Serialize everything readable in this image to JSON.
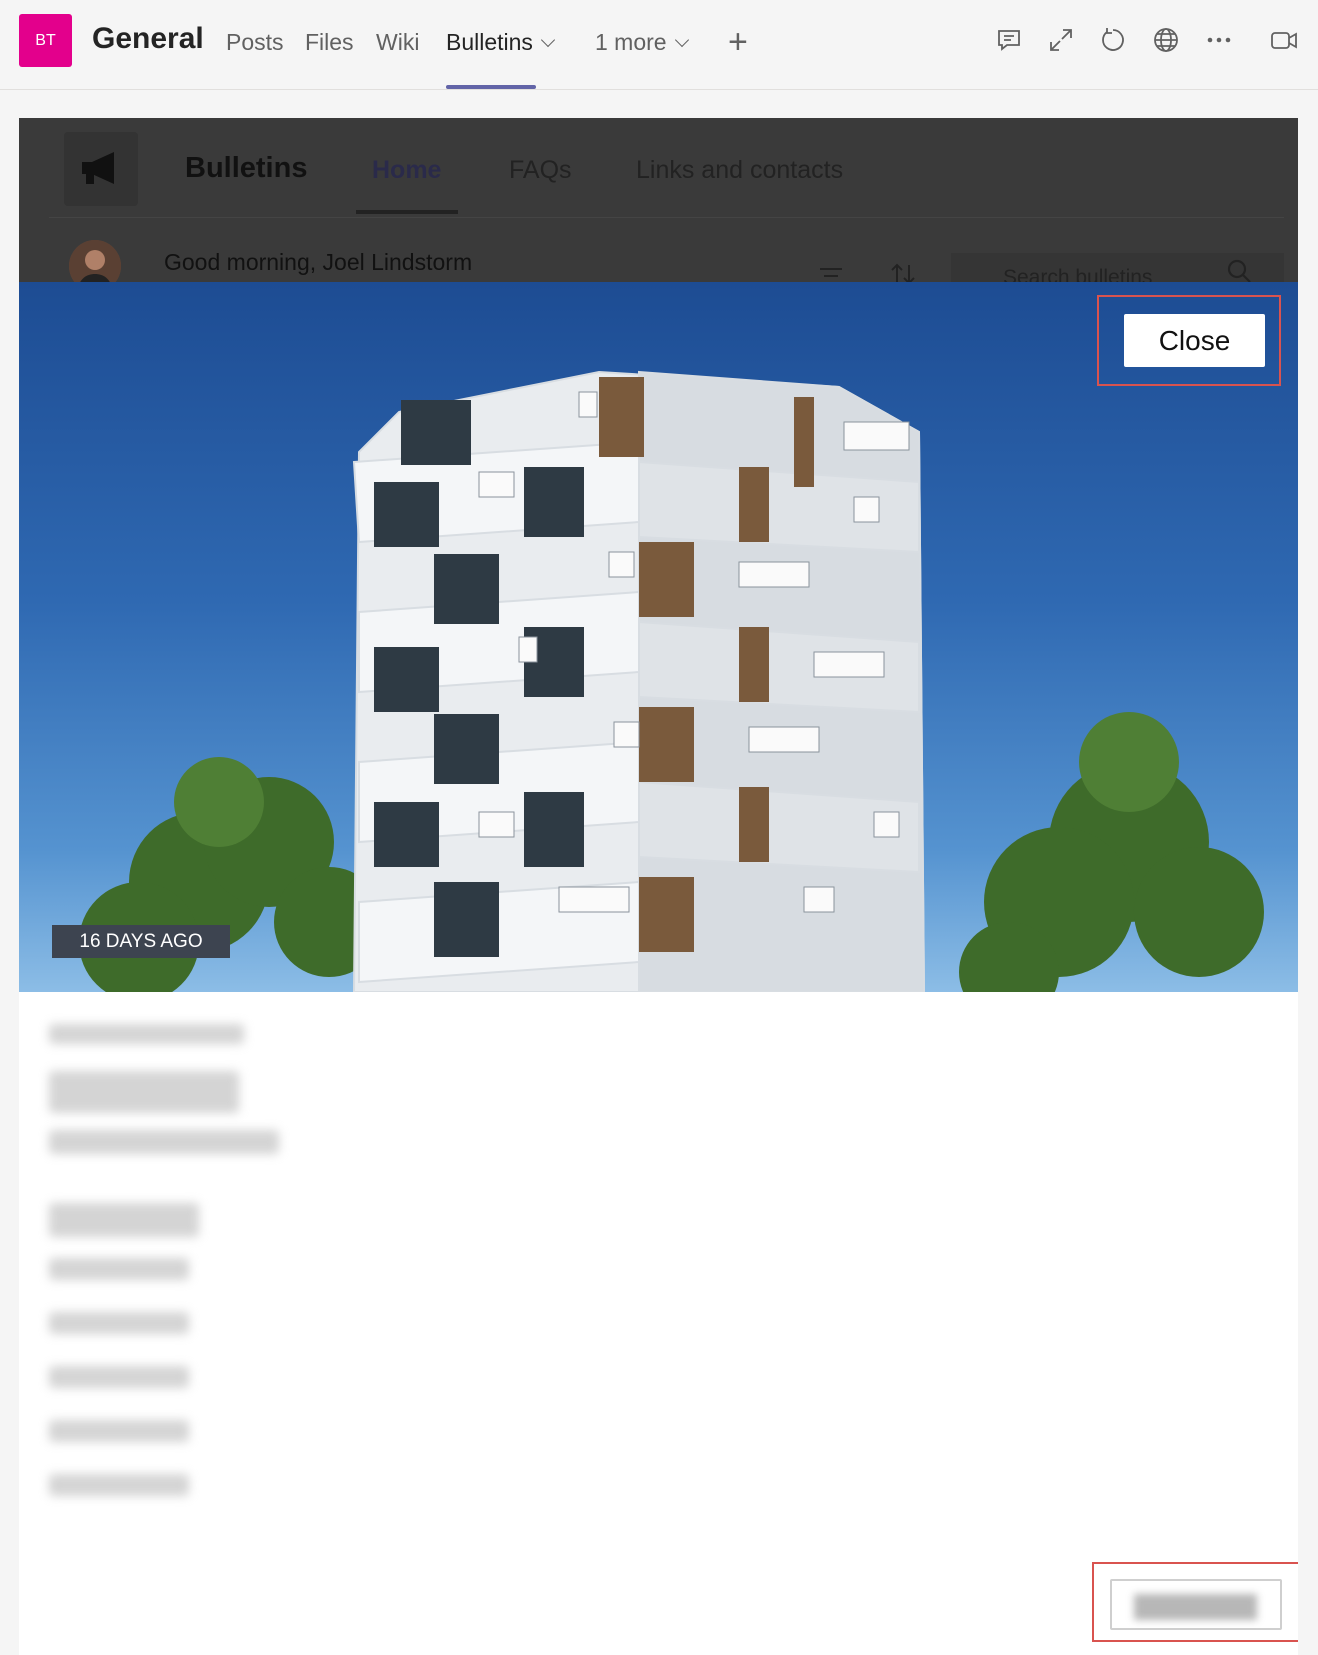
{
  "teams_header": {
    "team_avatar": "BT",
    "channel_name": "General",
    "tabs": [
      {
        "label": "Posts"
      },
      {
        "label": "Files"
      },
      {
        "label": "Wiki"
      },
      {
        "label": "Bulletins"
      },
      {
        "label": "1 more"
      }
    ],
    "active_tab": "Bulletins",
    "accent_color": "#6264a7",
    "avatar_color": "#e3008c",
    "right_icons": [
      "conversation-icon",
      "expand-icon",
      "refresh-icon",
      "globe-icon",
      "more-icon",
      "meet-icon"
    ]
  },
  "bulletins_app": {
    "title": "Bulletins",
    "tabs": [
      {
        "label": "Home"
      },
      {
        "label": "FAQs"
      },
      {
        "label": "Links and contacts"
      }
    ],
    "greeting": "Good morning, Joel Lindstorm",
    "search_placeholder": "Search bulletins"
  },
  "bulletin_detail": {
    "posted": "16 DAYS AGO",
    "close_label": "Close",
    "highlight_color": "#d9534f"
  }
}
